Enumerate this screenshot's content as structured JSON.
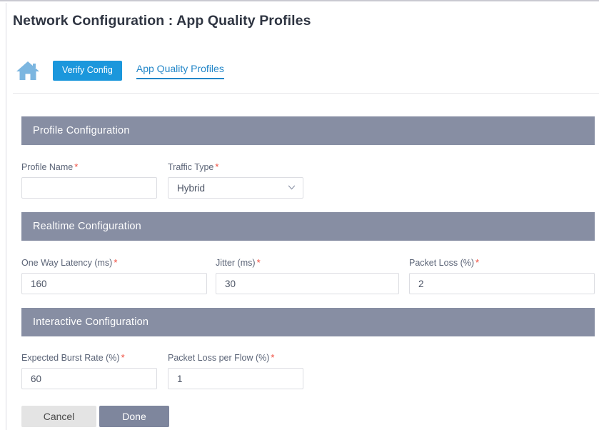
{
  "page": {
    "title": "Network Configuration : App Quality Profiles"
  },
  "navstrip": {
    "home_icon": "home-icon",
    "verify_config_label": "Verify Config",
    "active_tab_label": "App Quality Profiles"
  },
  "colors": {
    "accent_blue": "#1b97dc",
    "tab_blue": "#2286c8",
    "section_header": "#878ea3",
    "done_button": "#7e869d",
    "cancel_button": "#e4e4e4",
    "required_asterisk": "#ef4a3c",
    "label_text": "#5b6477"
  },
  "sections": [
    {
      "title": "Profile Configuration",
      "fields": [
        {
          "label": "Profile Name",
          "required": "*",
          "value": "",
          "placeholder": "",
          "type": "text"
        },
        {
          "label": "Traffic Type",
          "required": "*",
          "value": "Hybrid",
          "placeholder": "",
          "type": "select",
          "options": [
            "Hybrid"
          ]
        }
      ]
    },
    {
      "title": "Realtime Configuration",
      "fields": [
        {
          "label": "One Way Latency (ms)",
          "required": "*",
          "value": "160",
          "placeholder": "",
          "type": "text"
        },
        {
          "label": "Jitter (ms)",
          "required": "*",
          "value": "30",
          "placeholder": "",
          "type": "text"
        },
        {
          "label": "Packet Loss (%)",
          "required": "*",
          "value": "2",
          "placeholder": "",
          "type": "text"
        }
      ]
    },
    {
      "title": "Interactive Configuration",
      "fields": [
        {
          "label": "Expected Burst Rate (%)",
          "required": "*",
          "value": "60",
          "placeholder": "",
          "type": "text"
        },
        {
          "label": "Packet Loss per Flow (%)",
          "required": "*",
          "value": "1",
          "placeholder": "",
          "type": "text"
        }
      ]
    }
  ],
  "footer": {
    "cancel_label": "Cancel",
    "done_label": "Done"
  }
}
